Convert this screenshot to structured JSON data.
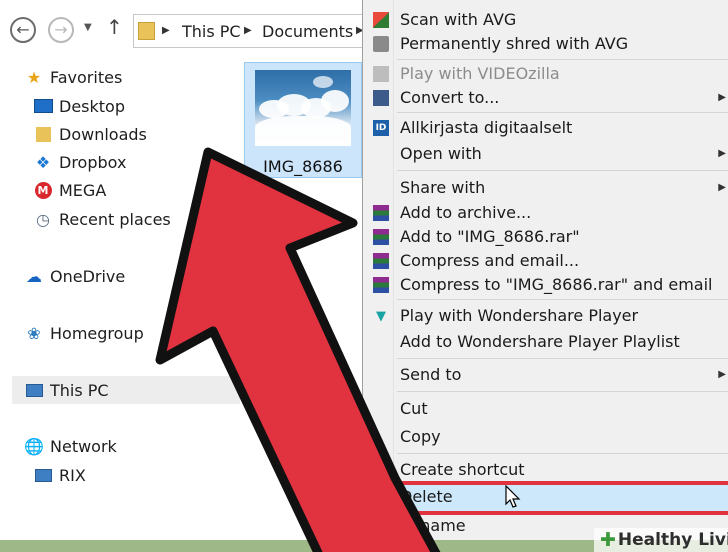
{
  "address_bar": {
    "crumbs": [
      "This PC",
      "Documents"
    ]
  },
  "sidebar": {
    "favorites_label": "Favorites",
    "favorites": [
      {
        "label": "Desktop",
        "icon": "desktop-icon"
      },
      {
        "label": "Downloads",
        "icon": "downloads-folder-icon"
      },
      {
        "label": "Dropbox",
        "icon": "dropbox-icon"
      },
      {
        "label": "MEGA",
        "icon": "mega-icon"
      },
      {
        "label": "Recent places",
        "icon": "recent-places-icon"
      }
    ],
    "onedrive": "OneDrive",
    "homegroup": "Homegroup",
    "this_pc": "This PC",
    "network": "Network",
    "network_child": "RIX"
  },
  "file": {
    "name": "IMG_8686"
  },
  "context_menu": {
    "items": [
      {
        "label": "Scan with AVG",
        "icon": "avg-icon"
      },
      {
        "label": "Permanently shred with AVG",
        "icon": "shredder-icon"
      },
      {
        "label": "Play with VIDEOzilla",
        "icon": "videozilla-icon",
        "disabled": true
      },
      {
        "label": "Convert to...",
        "icon": "convert-icon",
        "submenu": true
      },
      {
        "label": "Allkirjasta digitaalselt",
        "icon": "digital-signature-icon"
      },
      {
        "label": "Open with",
        "submenu": true
      },
      {
        "label": "Share with",
        "submenu": true
      },
      {
        "label": "Add to archive...",
        "icon": "winrar-icon"
      },
      {
        "label": "Add to \"IMG_8686.rar\"",
        "icon": "winrar-icon"
      },
      {
        "label": "Compress and email...",
        "icon": "winrar-icon"
      },
      {
        "label": "Compress to \"IMG_8686.rar\" and email",
        "icon": "winrar-icon"
      },
      {
        "label": "Play with Wondershare Player",
        "icon": "wondershare-icon"
      },
      {
        "label": "Add to Wondershare Player Playlist"
      },
      {
        "label": "Send to",
        "submenu": true
      },
      {
        "label": "Cut"
      },
      {
        "label": "Copy"
      },
      {
        "label": "Create shortcut"
      },
      {
        "label": "Delete",
        "highlighted": true
      },
      {
        "label": "Rename"
      }
    ]
  },
  "watermark": {
    "text": "Healthy Living"
  },
  "colors": {
    "arrow_fill": "#e0323f",
    "highlight_bg": "#cde8fb",
    "highlight_border": "#e0323f",
    "menu_bg": "#f0f0f0",
    "frame": "#9fb887"
  }
}
